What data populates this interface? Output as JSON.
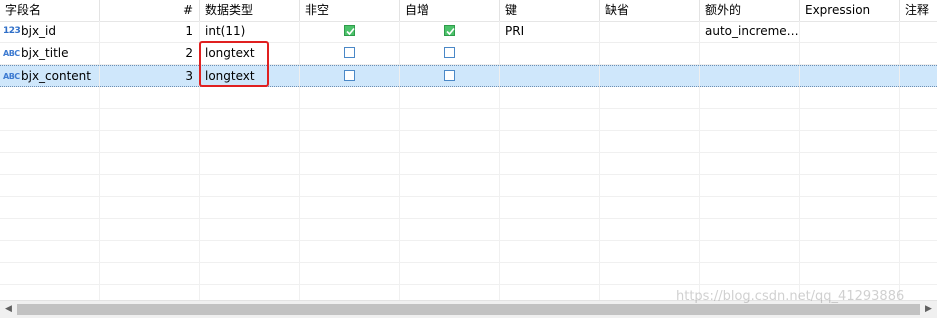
{
  "columns": [
    {
      "label": "字段名"
    },
    {
      "label": "#"
    },
    {
      "label": "数据类型"
    },
    {
      "label": "非空"
    },
    {
      "label": "自增"
    },
    {
      "label": "键"
    },
    {
      "label": "缺省"
    },
    {
      "label": "额外的"
    },
    {
      "label": "Expression"
    },
    {
      "label": "注释"
    }
  ],
  "rows": [
    {
      "type_icon": "123",
      "name": "bjx_id",
      "num": "1",
      "datatype": "int(11)",
      "not_null": true,
      "auto_inc": true,
      "key": "PRI",
      "default": "",
      "extra": "auto_increme…",
      "expression": "",
      "comment": ""
    },
    {
      "type_icon": "ABC",
      "name": "bjx_title",
      "num": "2",
      "datatype": "longtext",
      "not_null": false,
      "auto_inc": false,
      "key": "",
      "default": "",
      "extra": "",
      "expression": "",
      "comment": ""
    },
    {
      "type_icon": "ABC",
      "name": "bjx_content",
      "num": "3",
      "datatype": "longtext",
      "not_null": false,
      "auto_inc": false,
      "key": "",
      "default": "",
      "extra": "",
      "expression": "",
      "comment": "",
      "selected": true
    }
  ],
  "watermark": "https://blog.csdn.net/qq_41293886",
  "colors": {
    "selected_row": "#cfe7fb",
    "checkbox_on": "#4bc26a",
    "highlight_box": "#e02020"
  }
}
